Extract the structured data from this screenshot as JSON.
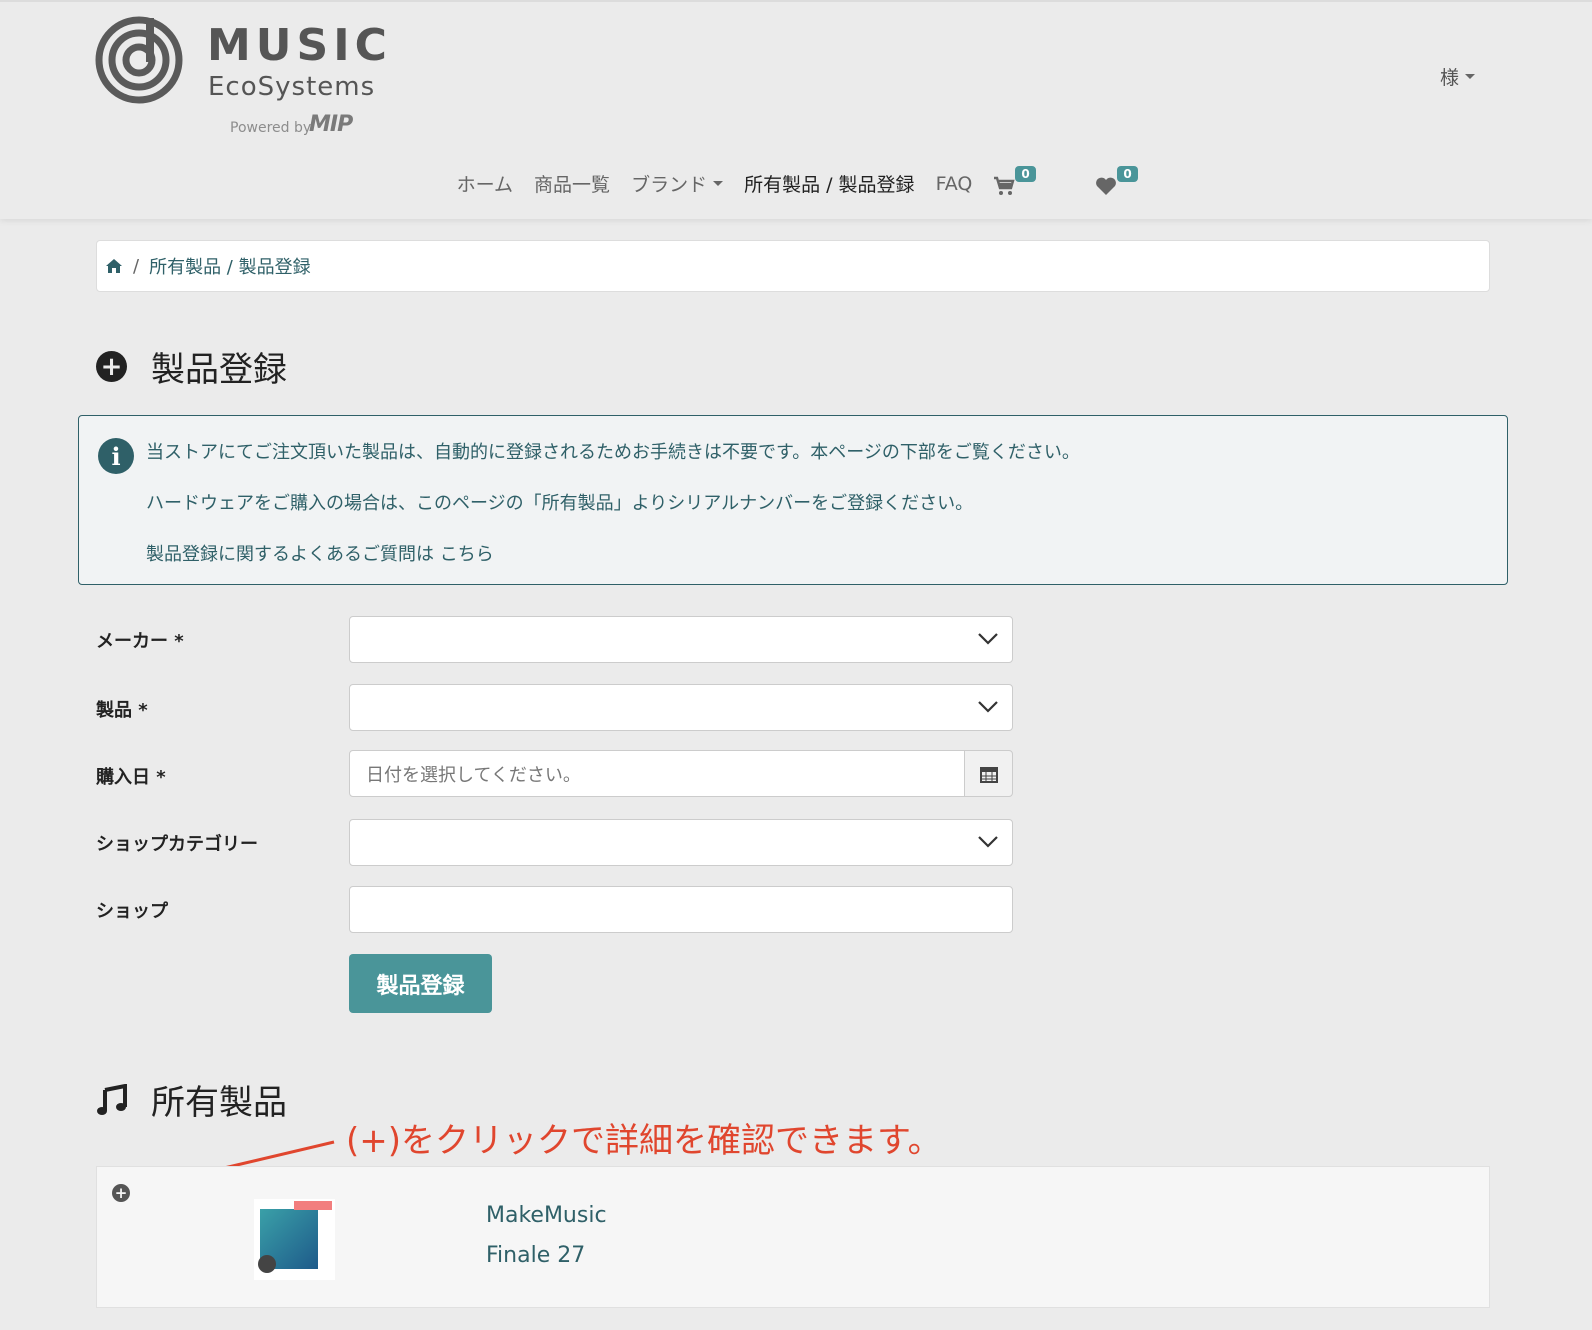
{
  "header": {
    "logo_word1": "MUSIC",
    "logo_word2": "EcoSystems",
    "logo_powered": "Powered by",
    "logo_mark": "MIP",
    "user_label": "様",
    "nav": [
      {
        "label": "ホーム",
        "active": false
      },
      {
        "label": "商品一覧",
        "active": false
      },
      {
        "label": "ブランド",
        "active": false,
        "dropdown": true
      },
      {
        "label": "所有製品 / 製品登録",
        "active": true
      },
      {
        "label": "FAQ",
        "active": false
      }
    ],
    "cart_count": "0",
    "wishlist_count": "0"
  },
  "breadcrumb": {
    "home_icon": "home-icon",
    "sep": "/",
    "current": "所有製品 / 製品登録"
  },
  "register_section": {
    "title": "製品登録",
    "icon": "plus-circle-icon",
    "plus_symbol": "+"
  },
  "info": {
    "icon_char": "i",
    "line1": "当ストアにてご注文頂いた製品は、自動的に登録されるためお手続きは不要です。本ページの下部をご覧ください。",
    "line2": "ハードウェアをご購入の場合は、このページの「所有製品」よりシリアルナンバーをご登録ください。",
    "line3_text": "製品登録に関するよくあるご質問は",
    "line3_link": "こちら"
  },
  "form": {
    "maker_label": "メーカー",
    "product_label": "製品",
    "date_label": "購入日",
    "required_mark": "*",
    "date_placeholder": "日付を選択してください。",
    "shop_category_label": "ショップカテゴリー",
    "shop_label": "ショップ",
    "submit_label": "製品登録"
  },
  "owned_section": {
    "title": "所有製品",
    "icon": "music-note-icon",
    "annotation": "(+)をクリックで詳細を確認できます。",
    "products": [
      {
        "brand": "MakeMusic",
        "name": "Finale 27",
        "expand_symbol": "+"
      }
    ]
  },
  "colors": {
    "teal": "#4a9599",
    "dark_teal": "#2f6068",
    "annotation_red": "#e0462e",
    "background": "#ebebeb"
  }
}
